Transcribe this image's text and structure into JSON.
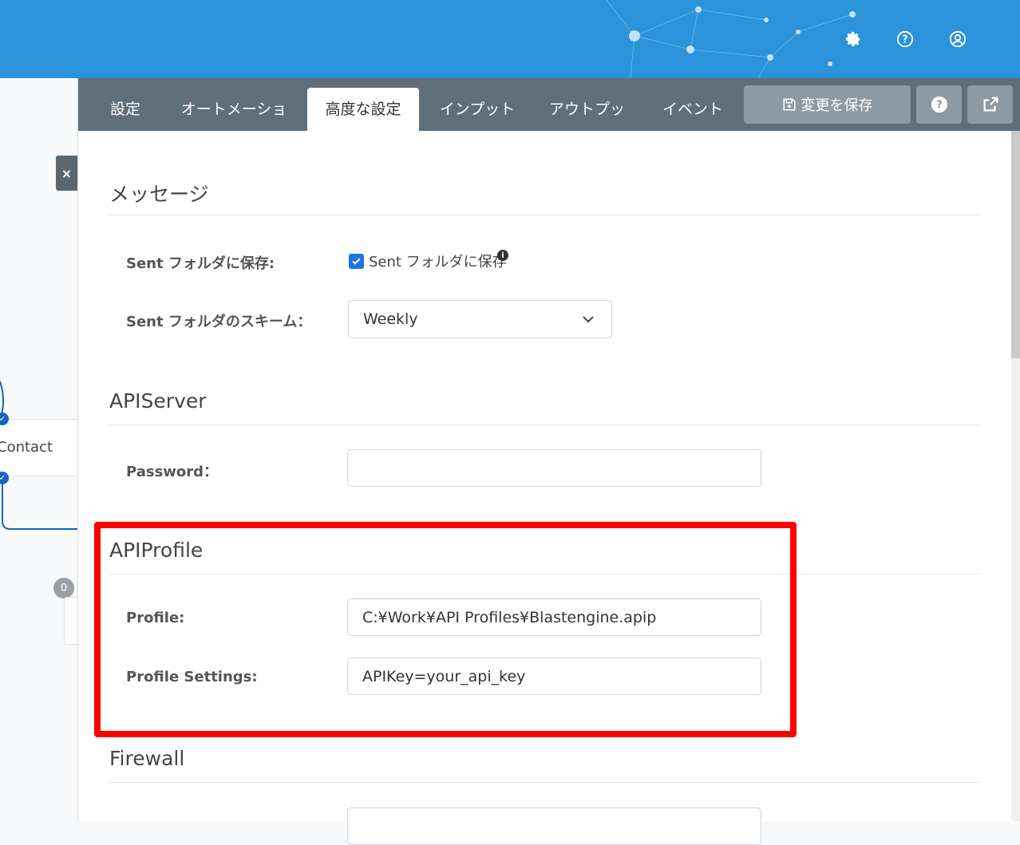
{
  "header": {
    "icons": [
      "gear-icon",
      "help-circle-icon",
      "user-circle-icon"
    ],
    "bg_color": "#2a93d9"
  },
  "canvas": {
    "close_label": "×",
    "node_label": "Contact",
    "badge_count": "0"
  },
  "tabs": [
    {
      "label": "設定"
    },
    {
      "label": "オートメーション"
    },
    {
      "label": "高度な設定"
    },
    {
      "label": "インプット"
    },
    {
      "label": "アウトプット"
    },
    {
      "label": "イベント"
    }
  ],
  "active_tab": "高度な設定",
  "toolbar": {
    "save_label": "変更を保存",
    "help_icon": "question-circle-icon",
    "external_icon": "external-link-icon"
  },
  "sections": {
    "message": {
      "title": "メッセージ",
      "sent_label": "Sent フォルダに保存:",
      "sent_checkbox_label": "Sent フォルダに保存",
      "sent_checked": true,
      "scheme_label": "Sent フォルダのスキーム：",
      "scheme_value": "Weekly"
    },
    "apiserver": {
      "title": "APIServer",
      "password_label": "Password：",
      "password_value": ""
    },
    "apiprofile": {
      "title": "APIProfile",
      "profile_label": "Profile:",
      "profile_value": "C:¥Work¥API Profiles¥Blastengine.apip",
      "settings_label": "Profile Settings:",
      "settings_value": "APIKey=your_api_key"
    },
    "firewall": {
      "title": "Firewall"
    }
  },
  "highlight_color": "#ff0000"
}
